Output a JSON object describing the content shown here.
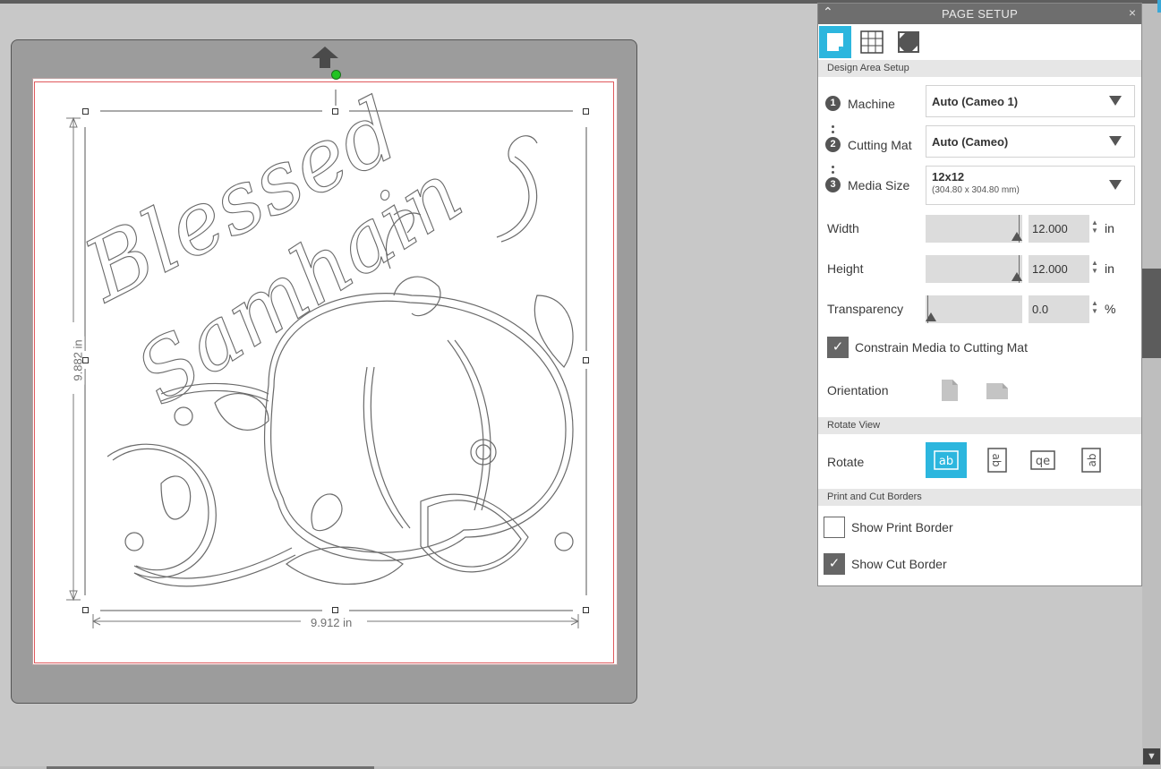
{
  "panel": {
    "title": "PAGE SETUP",
    "collapse_glyph": "^",
    "close_glyph": "×",
    "tabs": [
      {
        "icon": "page-icon",
        "active": true
      },
      {
        "icon": "grid-icon",
        "active": false
      },
      {
        "icon": "registration-marks-icon",
        "active": false
      }
    ],
    "design_area_section": "Design Area Setup",
    "machine": {
      "step": "1",
      "label": "Machine",
      "value": "Auto (Cameo 1)"
    },
    "cutting_mat": {
      "step": "2",
      "label": "Cutting Mat",
      "value": "Auto (Cameo)"
    },
    "media_size": {
      "step": "3",
      "label": "Media Size",
      "value": "12x12",
      "sub": "(304.80 x 304.80 mm)"
    },
    "width": {
      "label": "Width",
      "value": "12.000",
      "unit": "in",
      "slider_fraction": 0.95
    },
    "height": {
      "label": "Height",
      "value": "12.000",
      "unit": "in",
      "slider_fraction": 0.95
    },
    "transparency": {
      "label": "Transparency",
      "value": "0.0",
      "unit": "%",
      "slider_fraction": 0.0
    },
    "constrain": {
      "label": "Constrain Media to Cutting Mat",
      "checked": true
    },
    "orientation": {
      "label": "Orientation"
    },
    "rotate_section": "Rotate View",
    "rotate": {
      "label": "Rotate",
      "options": [
        "ab",
        "ab",
        "qe",
        "ab"
      ],
      "active_index": 0
    },
    "borders_section": "Print and Cut Borders",
    "show_print_border": {
      "label": "Show Print Border",
      "checked": false
    },
    "show_cut_border": {
      "label": "Show Cut Border",
      "checked": true
    }
  },
  "canvas": {
    "width_dimension": "9.912 in",
    "height_dimension": "9.882 in",
    "design_text_line1": "Blessed",
    "design_text_line2": "Samhain"
  },
  "colors": {
    "accent": "#2cb6de",
    "panel_header": "#6e6e6e",
    "mat": "#9c9c9c",
    "cut_border": "#e0595c",
    "handle_green": "#22c322"
  }
}
